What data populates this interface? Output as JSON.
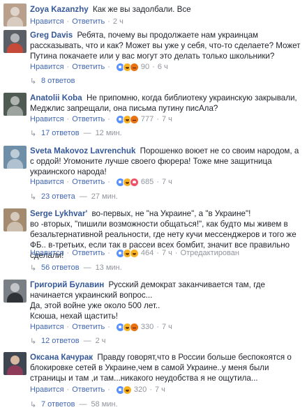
{
  "ui": {
    "like": "Нравится",
    "reply": "Ответить",
    "dot": "·",
    "dash": "—",
    "edited": "Отредактирован"
  },
  "colors": {
    "link": "#365899",
    "action": "#4267b2",
    "muted": "#90949c",
    "text": "#1d2129"
  },
  "comments": [
    {
      "author": "Zoya Kazanzhy",
      "text": "Как же вы задолбали. Все",
      "reactions": [],
      "count": "",
      "time": "2 ч"
    },
    {
      "author": "Greg Davis",
      "text": "Ребята, почему вы продолжаете нам украинцам рассказывать, что и как? Может вы уже у себя, что-то сделаете? Может Путина покачаете или у вас могут это делать только школьники?",
      "reactions": [
        "like-icon",
        "haha-icon",
        "angry-icon"
      ],
      "count": "90",
      "time": "6 ч",
      "replies": "8 ответов",
      "replies_time": ""
    },
    {
      "author": "Anatolii Koba",
      "text": "Не припомню, когда библиотеку украинскую закрывали, Меджлис запрещали, она письма путину пиcАла?",
      "reactions": [
        "like-icon",
        "haha-icon",
        "angry-icon"
      ],
      "count": "777",
      "time": "7 ч",
      "replies": "17 ответов",
      "replies_time": "12 мин."
    },
    {
      "author": "Sveta Makovoz Lavrenchuk",
      "text": "Порошенко воюет не со своим народом, а с ордой! Угомоните лучше своего фюрера! Тоже мне защитница украинского народа!",
      "reactions": [
        "like-icon",
        "haha-icon",
        "love-icon"
      ],
      "count": "685",
      "time": "7 ч",
      "replies": "23 ответа",
      "replies_time": "27 мин."
    },
    {
      "author": "Serge Lykhvar'",
      "text_lines": [
        "во-первых, не \"на Украине\", а \"в Украине\"!",
        "во -вторых, \"пишили возможности общаться!\", как будто мы живем в безальтернативной реальности, где нету кучи мессенджеров и того же ФБ.. в-третьих, если так в рассеи всех бомбит, значит все правильно сделали!"
      ],
      "reactions": [
        "like-icon",
        "haha-icon",
        "wow-icon"
      ],
      "count": "464",
      "time": "7 ч",
      "edited": true,
      "replies": "56 ответов",
      "replies_time": "13 мин."
    },
    {
      "author": "Григорий Булавин",
      "text_lines": [
        "Русский демократ заканчивается там, где начинается украинский вопрос...",
        "Да, этой войне уже около 500 лет..",
        "Ксюша, нехай щастить!"
      ],
      "reactions": [
        "like-icon",
        "haha-icon",
        "angry-icon"
      ],
      "count": "330",
      "time": "7 ч",
      "replies": "12 ответов",
      "replies_time": "2 ч"
    },
    {
      "author": "Оксана Качурак",
      "text": "Правду говорят,что в России больше беспокоятся о блокировке сетей в Украине,чем в самой Украине..у меня были страницы и там ,и там...никакого неудобства я не ощутила...",
      "reactions": [
        "like-icon",
        "haha-icon"
      ],
      "count": "320",
      "time": "7 ч",
      "replies": "7 ответов",
      "replies_time": "58 мин."
    }
  ]
}
